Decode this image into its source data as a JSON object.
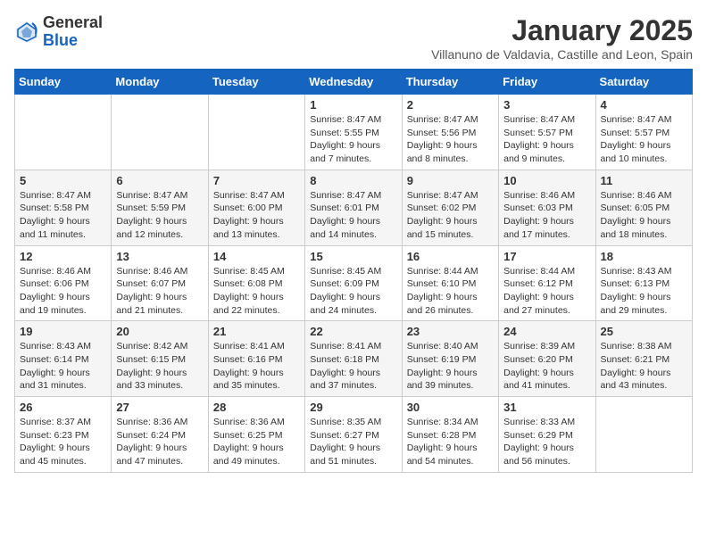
{
  "header": {
    "logo_general": "General",
    "logo_blue": "Blue",
    "month_title": "January 2025",
    "subtitle": "Villanuno de Valdavia, Castille and Leon, Spain"
  },
  "weekdays": [
    "Sunday",
    "Monday",
    "Tuesday",
    "Wednesday",
    "Thursday",
    "Friday",
    "Saturday"
  ],
  "weeks": [
    [
      {
        "day": "",
        "info": ""
      },
      {
        "day": "",
        "info": ""
      },
      {
        "day": "",
        "info": ""
      },
      {
        "day": "1",
        "info": "Sunrise: 8:47 AM\nSunset: 5:55 PM\nDaylight: 9 hours\nand 7 minutes."
      },
      {
        "day": "2",
        "info": "Sunrise: 8:47 AM\nSunset: 5:56 PM\nDaylight: 9 hours\nand 8 minutes."
      },
      {
        "day": "3",
        "info": "Sunrise: 8:47 AM\nSunset: 5:57 PM\nDaylight: 9 hours\nand 9 minutes."
      },
      {
        "day": "4",
        "info": "Sunrise: 8:47 AM\nSunset: 5:57 PM\nDaylight: 9 hours\nand 10 minutes."
      }
    ],
    [
      {
        "day": "5",
        "info": "Sunrise: 8:47 AM\nSunset: 5:58 PM\nDaylight: 9 hours\nand 11 minutes."
      },
      {
        "day": "6",
        "info": "Sunrise: 8:47 AM\nSunset: 5:59 PM\nDaylight: 9 hours\nand 12 minutes."
      },
      {
        "day": "7",
        "info": "Sunrise: 8:47 AM\nSunset: 6:00 PM\nDaylight: 9 hours\nand 13 minutes."
      },
      {
        "day": "8",
        "info": "Sunrise: 8:47 AM\nSunset: 6:01 PM\nDaylight: 9 hours\nand 14 minutes."
      },
      {
        "day": "9",
        "info": "Sunrise: 8:47 AM\nSunset: 6:02 PM\nDaylight: 9 hours\nand 15 minutes."
      },
      {
        "day": "10",
        "info": "Sunrise: 8:46 AM\nSunset: 6:03 PM\nDaylight: 9 hours\nand 17 minutes."
      },
      {
        "day": "11",
        "info": "Sunrise: 8:46 AM\nSunset: 6:05 PM\nDaylight: 9 hours\nand 18 minutes."
      }
    ],
    [
      {
        "day": "12",
        "info": "Sunrise: 8:46 AM\nSunset: 6:06 PM\nDaylight: 9 hours\nand 19 minutes."
      },
      {
        "day": "13",
        "info": "Sunrise: 8:46 AM\nSunset: 6:07 PM\nDaylight: 9 hours\nand 21 minutes."
      },
      {
        "day": "14",
        "info": "Sunrise: 8:45 AM\nSunset: 6:08 PM\nDaylight: 9 hours\nand 22 minutes."
      },
      {
        "day": "15",
        "info": "Sunrise: 8:45 AM\nSunset: 6:09 PM\nDaylight: 9 hours\nand 24 minutes."
      },
      {
        "day": "16",
        "info": "Sunrise: 8:44 AM\nSunset: 6:10 PM\nDaylight: 9 hours\nand 26 minutes."
      },
      {
        "day": "17",
        "info": "Sunrise: 8:44 AM\nSunset: 6:12 PM\nDaylight: 9 hours\nand 27 minutes."
      },
      {
        "day": "18",
        "info": "Sunrise: 8:43 AM\nSunset: 6:13 PM\nDaylight: 9 hours\nand 29 minutes."
      }
    ],
    [
      {
        "day": "19",
        "info": "Sunrise: 8:43 AM\nSunset: 6:14 PM\nDaylight: 9 hours\nand 31 minutes."
      },
      {
        "day": "20",
        "info": "Sunrise: 8:42 AM\nSunset: 6:15 PM\nDaylight: 9 hours\nand 33 minutes."
      },
      {
        "day": "21",
        "info": "Sunrise: 8:41 AM\nSunset: 6:16 PM\nDaylight: 9 hours\nand 35 minutes."
      },
      {
        "day": "22",
        "info": "Sunrise: 8:41 AM\nSunset: 6:18 PM\nDaylight: 9 hours\nand 37 minutes."
      },
      {
        "day": "23",
        "info": "Sunrise: 8:40 AM\nSunset: 6:19 PM\nDaylight: 9 hours\nand 39 minutes."
      },
      {
        "day": "24",
        "info": "Sunrise: 8:39 AM\nSunset: 6:20 PM\nDaylight: 9 hours\nand 41 minutes."
      },
      {
        "day": "25",
        "info": "Sunrise: 8:38 AM\nSunset: 6:21 PM\nDaylight: 9 hours\nand 43 minutes."
      }
    ],
    [
      {
        "day": "26",
        "info": "Sunrise: 8:37 AM\nSunset: 6:23 PM\nDaylight: 9 hours\nand 45 minutes."
      },
      {
        "day": "27",
        "info": "Sunrise: 8:36 AM\nSunset: 6:24 PM\nDaylight: 9 hours\nand 47 minutes."
      },
      {
        "day": "28",
        "info": "Sunrise: 8:36 AM\nSunset: 6:25 PM\nDaylight: 9 hours\nand 49 minutes."
      },
      {
        "day": "29",
        "info": "Sunrise: 8:35 AM\nSunset: 6:27 PM\nDaylight: 9 hours\nand 51 minutes."
      },
      {
        "day": "30",
        "info": "Sunrise: 8:34 AM\nSunset: 6:28 PM\nDaylight: 9 hours\nand 54 minutes."
      },
      {
        "day": "31",
        "info": "Sunrise: 8:33 AM\nSunset: 6:29 PM\nDaylight: 9 hours\nand 56 minutes."
      },
      {
        "day": "",
        "info": ""
      }
    ]
  ]
}
